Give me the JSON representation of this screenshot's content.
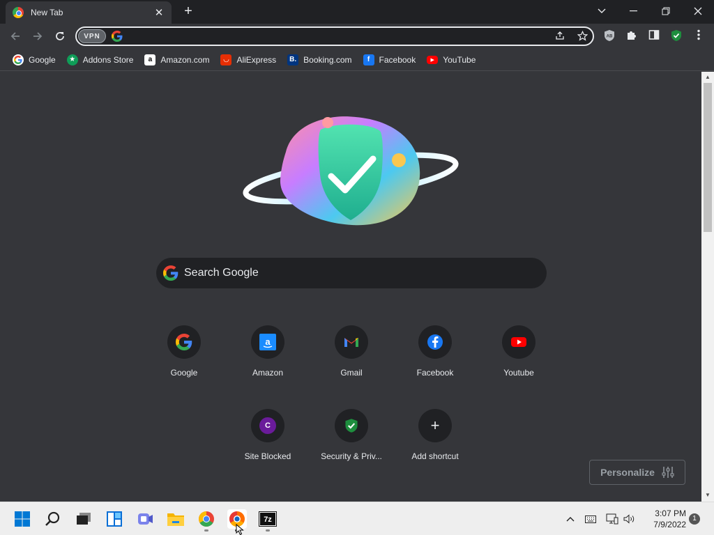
{
  "tab": {
    "title": "New Tab",
    "close": "✕"
  },
  "newtab": "+",
  "window_controls": {
    "dropdown": "⌄",
    "minimize": "─",
    "restore": "❐",
    "close": "✕"
  },
  "toolbar": {
    "vpn_label": "VPN"
  },
  "bookmarks": [
    {
      "label": "Google",
      "icon": "google-icon"
    },
    {
      "label": "Addons Store",
      "icon": "addons-store-icon"
    },
    {
      "label": "Amazon.com",
      "icon": "amazon-icon"
    },
    {
      "label": "AliExpress",
      "icon": "aliexpress-icon"
    },
    {
      "label": "Booking.com",
      "icon": "booking-icon"
    },
    {
      "label": "Facebook",
      "icon": "facebook-icon"
    },
    {
      "label": "YouTube",
      "icon": "youtube-icon"
    }
  ],
  "search": {
    "placeholder": "Search Google"
  },
  "shortcuts": [
    {
      "label": "Google",
      "icon": "google-icon"
    },
    {
      "label": "Amazon",
      "icon": "amazon-icon"
    },
    {
      "label": "Gmail",
      "icon": "gmail-icon"
    },
    {
      "label": "Facebook",
      "icon": "facebook-icon"
    },
    {
      "label": "Youtube",
      "icon": "youtube-icon"
    },
    {
      "label": "Site Blocked",
      "icon": "site-blocked-icon",
      "letter": "C"
    },
    {
      "label": "Security & Priv...",
      "icon": "security-shield-icon"
    },
    {
      "label": "Add shortcut",
      "icon": "plus-icon",
      "glyph": "+"
    }
  ],
  "personalize": {
    "label": "Personalize"
  },
  "taskbar": {
    "time": "3:07 PM",
    "date": "7/9/2022",
    "notifications": "1",
    "apps": [
      "start-icon",
      "search-icon",
      "task-view-icon",
      "widgets-icon",
      "teams-chat-icon",
      "file-explorer-icon",
      "chrome-icon",
      "browser-icon",
      "7zip-icon"
    ],
    "sevenzip_label": "7z"
  },
  "colors": {
    "background": "#35363a",
    "tabstrip": "#202124",
    "text": "#e8eaed",
    "taskbar": "#eeeeee"
  }
}
